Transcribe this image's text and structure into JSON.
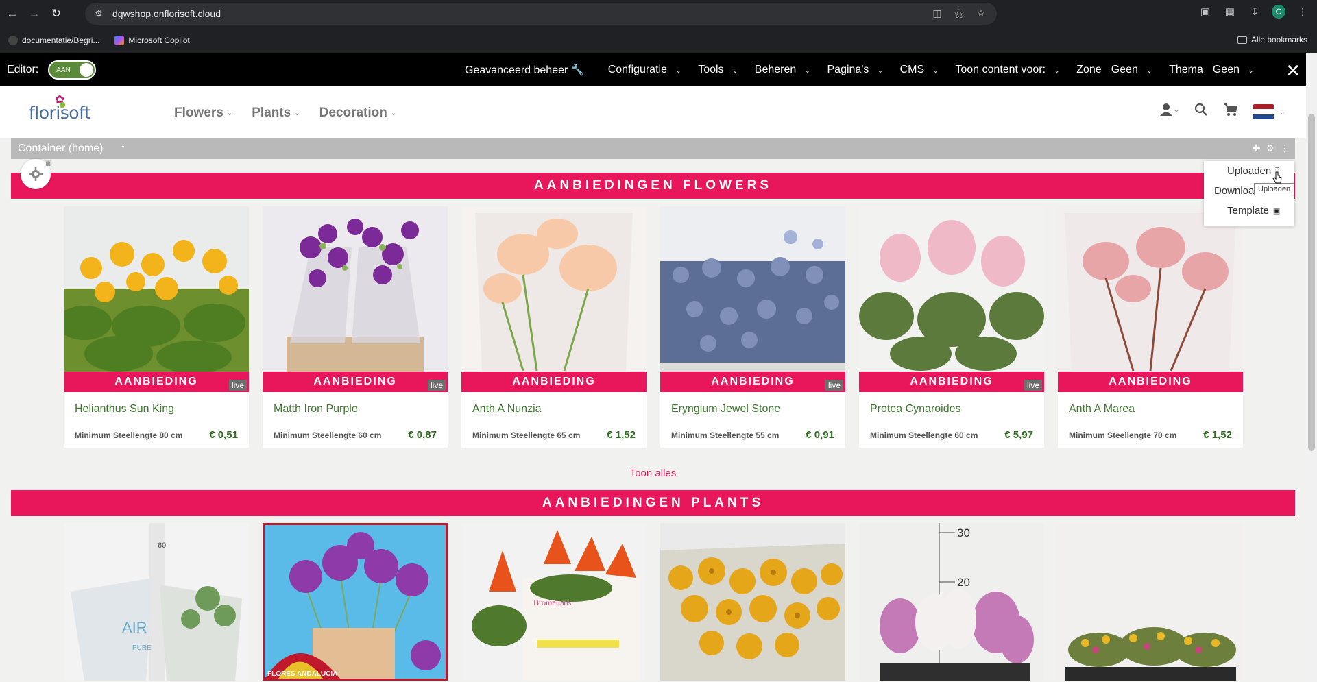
{
  "browser": {
    "url": "dgwshop.onflorisoft.cloud",
    "profile_initial": "C",
    "bookmarks": [
      {
        "label": "documentatie/Begri..."
      },
      {
        "label": "Microsoft Copilot"
      }
    ],
    "all_bookmarks_label": "Alle bookmarks"
  },
  "editor": {
    "label": "Editor:",
    "toggle_label": "AAN",
    "menus": [
      {
        "label": "Geavanceerd beheer 🔧"
      },
      {
        "label": "Configuratie"
      },
      {
        "label": "Tools"
      },
      {
        "label": "Beheren"
      },
      {
        "label": "Pagina's"
      },
      {
        "label": "CMS"
      },
      {
        "label": "Toon content voor:"
      }
    ],
    "zone_label": "Zone",
    "zone_value": "Geen",
    "theme_label": "Thema",
    "theme_value": "Geen"
  },
  "site": {
    "logo_text": "florisoft",
    "nav": [
      {
        "label": "Flowers"
      },
      {
        "label": "Plants"
      },
      {
        "label": "Decoration"
      }
    ]
  },
  "container": {
    "label": "Container (home)"
  },
  "dropdown": {
    "items": [
      {
        "label": "Uploaden"
      },
      {
        "label": "Download"
      },
      {
        "label": "Template"
      }
    ],
    "tooltip": "Uploaden"
  },
  "sections": {
    "flowers_title": "AANBIEDINGEN FLOWERS",
    "plants_title": "AANBIEDINGEN PLANTS",
    "toon_alles": "Toon alles"
  },
  "flower_products": [
    {
      "name": "Helianthus Sun King",
      "ribbon": "AANBIEDING",
      "live": "live",
      "stem": "Minimum Steellengte 80 cm",
      "price": "€ 0,51"
    },
    {
      "name": "Matth Iron Purple",
      "ribbon": "AANBIEDING",
      "live": "live",
      "stem": "Minimum Steellengte 60 cm",
      "price": "€ 0,87"
    },
    {
      "name": "Anth A Nunzia",
      "ribbon": "AANBIEDING",
      "live": "",
      "stem": "Minimum Steellengte 65 cm",
      "price": "€ 1,52"
    },
    {
      "name": "Eryngium Jewel Stone",
      "ribbon": "AANBIEDING",
      "live": "live",
      "stem": "Minimum Steellengte 55 cm",
      "price": "€ 0,91"
    },
    {
      "name": "Protea Cynaroides",
      "ribbon": "AANBIEDING",
      "live": "live",
      "stem": "Minimum Steellengte 60 cm",
      "price": "€ 5,97"
    },
    {
      "name": "Anth A Marea",
      "ribbon": "AANBIEDING",
      "live": "",
      "stem": "Minimum Steellengte 70 cm",
      "price": "€ 1,52"
    }
  ],
  "plant_image_texts": {
    "p1_ruler": "60",
    "p1_text": "AIR",
    "p1_text2": "PURE",
    "p2_text": "FLORES ANDALUCIA",
    "p3_text": "Bromeliads",
    "p5_ruler1": "30",
    "p5_ruler2": "20"
  },
  "colors": {
    "accent": "#e8165a",
    "product_name": "#3e7a2f",
    "editor_bar": "#000000",
    "toggle_on": "#5a8a3a"
  }
}
